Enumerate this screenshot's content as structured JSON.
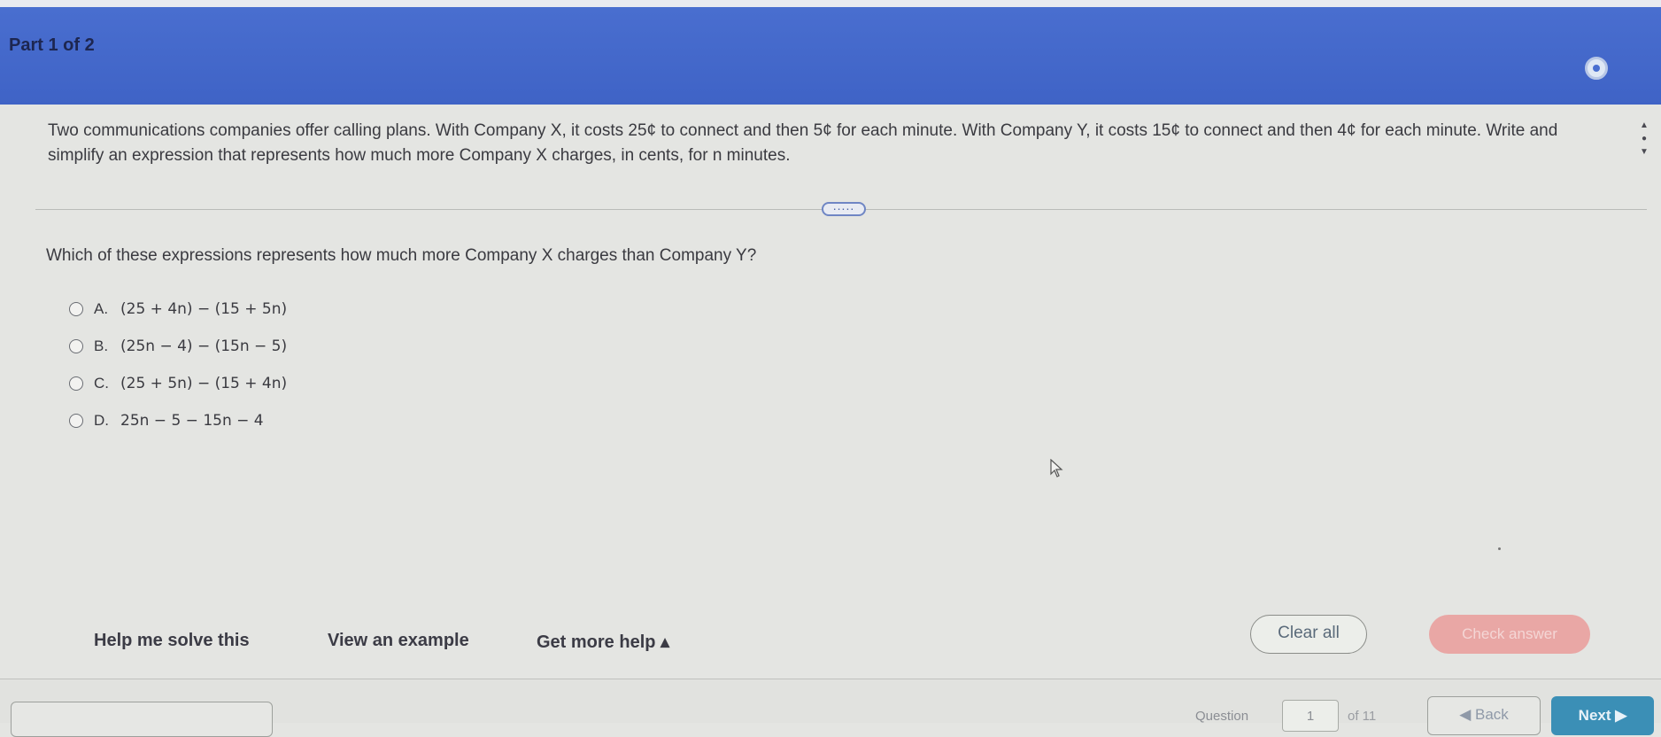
{
  "header": {
    "part_label": "Part 1 of 2",
    "accent_color": "#4a6fd0"
  },
  "problem": {
    "text": "Two communications companies offer calling plans. With Company X, it costs 25¢ to connect and then 5¢ for each minute. With Company Y, it costs 15¢ to connect and then 4¢ for each minute. Write and simplify an expression that represents how much more Company X charges, in cents, for n minutes."
  },
  "more_toggle": {
    "label": "....."
  },
  "question": {
    "text": "Which of these expressions represents how much more Company X charges than Company Y?"
  },
  "choices": [
    {
      "letter": "A.",
      "expression": "(25 + 4n) − (15 + 5n)"
    },
    {
      "letter": "B.",
      "expression": "(25n − 4) − (15n − 5)"
    },
    {
      "letter": "C.",
      "expression": "(25 + 5n) − (15 + 4n)"
    },
    {
      "letter": "D.",
      "expression": "25n − 5 − 15n − 4"
    }
  ],
  "help": {
    "solve": "Help me solve this",
    "example": "View an example",
    "more": "Get more help ▴"
  },
  "actions": {
    "clear_all": "Clear all",
    "check_answer": "Check answer"
  },
  "footer": {
    "question_label": "Question",
    "question_number": "1",
    "of_label": "of 11",
    "back": "◀ Back",
    "next": "Next ▶"
  }
}
